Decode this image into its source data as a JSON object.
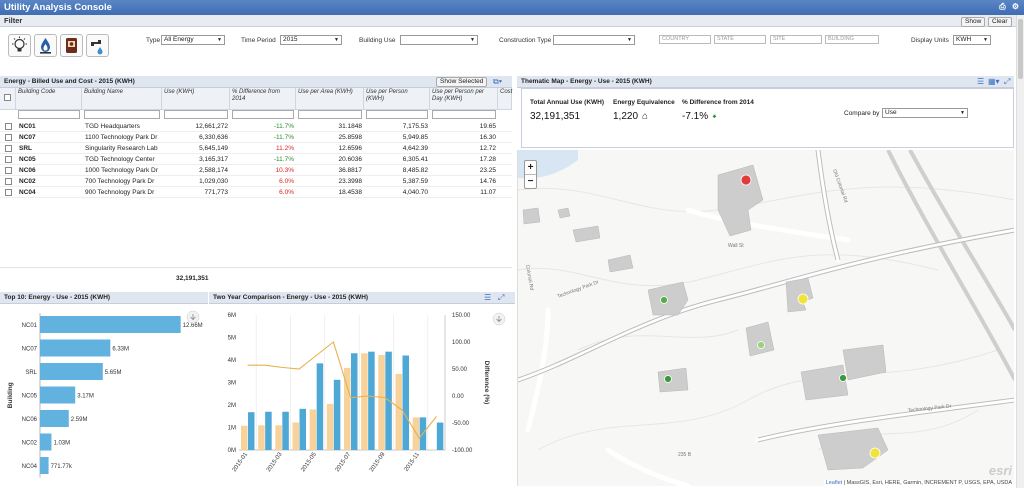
{
  "app": {
    "title": "Utility Analysis Console"
  },
  "filter": {
    "section_label": "Filter",
    "show_label": "Show",
    "clear_label": "Clear",
    "type_label": "Type",
    "type_value": "All Energy",
    "period_label": "Time Period",
    "period_value": "2015",
    "building_use_label": "Building Use",
    "building_use_value": "",
    "construction_label": "Construction Type",
    "construction_value": "",
    "country_ph": "COUNTRY",
    "state_ph": "STATE",
    "site_ph": "SITE",
    "building_ph": "BUILDING",
    "units_label": "Display Units",
    "units_value": "KWH",
    "icons": [
      "electricity-icon",
      "gas-icon",
      "fuel-oil-icon",
      "water-icon"
    ]
  },
  "grid": {
    "title": "Energy - Billed Use and Cost - 2015 (KWH)",
    "show_selected": "Show Selected",
    "columns": [
      "Building Code",
      "Building Name",
      "Use (KWH)",
      "% Difference from 2014",
      "Use per Area (KWH)",
      "Use per Person (KWH)",
      "Use per Person per Day (KWH)",
      "Cost"
    ],
    "rows": [
      {
        "code": "NC01",
        "name": "TGD Headquarters",
        "use": "12,661,272",
        "diff": "-11.7%",
        "area": "31.1848",
        "person": "7,175.53",
        "day": "19.65",
        "neg": false
      },
      {
        "code": "NC07",
        "name": "1100 Technology Park Dr",
        "use": "6,330,636",
        "diff": "-11.7%",
        "area": "25.8598",
        "person": "5,949.85",
        "day": "16.30",
        "neg": false
      },
      {
        "code": "SRL",
        "name": "Singularity Research Lab",
        "use": "5,645,149",
        "diff": "11.2%",
        "area": "12.6596",
        "person": "4,642.39",
        "day": "12.72",
        "neg": true
      },
      {
        "code": "NC05",
        "name": "TGD Technology Center",
        "use": "3,165,317",
        "diff": "-11.7%",
        "area": "20.6036",
        "person": "6,305.41",
        "day": "17.28",
        "neg": false
      },
      {
        "code": "NC06",
        "name": "1000 Technology Park Dr",
        "use": "2,588,174",
        "diff": "10.3%",
        "area": "36.8817",
        "person": "8,485.82",
        "day": "23.25",
        "neg": true
      },
      {
        "code": "NC02",
        "name": "700 Technology Park Dr",
        "use": "1,029,030",
        "diff": "6.0%",
        "area": "23.3998",
        "person": "5,387.59",
        "day": "14.76",
        "neg": true
      },
      {
        "code": "NC04",
        "name": "900 Technology Park Dr",
        "use": "771,773",
        "diff": "6.0%",
        "area": "18.4538",
        "person": "4,040.70",
        "day": "11.07",
        "neg": true
      }
    ],
    "total": "32,191,351"
  },
  "thematic": {
    "title": "Thematic Map - Energy - Use - 2015 (KWH)",
    "total_label": "Total Annual Use (KWH)",
    "total_value": "32,191,351",
    "equiv_label": "Energy Equivalence",
    "equiv_value": "1,220",
    "diff_label": "% Difference from 2014",
    "diff_value": "-7.1%",
    "compare_label": "Compare by",
    "compare_value": "Use"
  },
  "map": {
    "streets": [
      "Old Colonial Rd",
      "Wall St",
      "Technology Park Dr",
      "Technology Park Dr",
      "Colonial Rd",
      "235 B"
    ],
    "attribution_link": "Leaflet",
    "attribution": "| MassGIS, Esri, HERE, Garmin, INCREMENT P, USGS, EPA, USDA",
    "watermark": "esri",
    "markers": [
      {
        "name": "NC01",
        "color": "#e23b3b"
      },
      {
        "name": "NC07",
        "color": "#f2e33a"
      },
      {
        "name": "SRL",
        "color": "#52b04a"
      },
      {
        "name": "NC05",
        "color": "#9bd07a"
      },
      {
        "name": "NC06",
        "color": "#3a9a3a"
      },
      {
        "name": "NC02",
        "color": "#3a9a3a"
      },
      {
        "name": "NC04",
        "color": "#f2e33a"
      }
    ]
  },
  "chart_data": [
    {
      "type": "bar",
      "orientation": "horizontal",
      "title": "Top 10: Energy - Use - 2015 (KWH)",
      "ylabel": "Building",
      "categories": [
        "NC01",
        "NC07",
        "SRL",
        "NC05",
        "NC06",
        "NC02",
        "NC04"
      ],
      "values": [
        12.66,
        6.33,
        5.65,
        3.17,
        2.59,
        1.03,
        0.77173
      ],
      "labels": [
        "12.66M",
        "6.33M",
        "5.65M",
        "3.17M",
        "2.59M",
        "1.03M",
        "771.77k"
      ],
      "xlim": [
        0,
        13.5
      ],
      "color": "#62b2e0"
    },
    {
      "type": "bar",
      "title": "Two Year Comparison - Energy - Use - 2015 (KWH)",
      "ylabel_right": "Difference (%)",
      "x": [
        "2015-01",
        "2015-02",
        "2015-03",
        "2015-04",
        "2015-05",
        "2015-06",
        "2015-07",
        "2015-08",
        "2015-09",
        "2015-10",
        "2015-11",
        "2015-12"
      ],
      "x_ticks": [
        "2015-01",
        "2015-03",
        "2015-05",
        "2015-07",
        "2015-09",
        "2015-11"
      ],
      "y_ticks": [
        "0M",
        "1M",
        "2M",
        "3M",
        "4M",
        "5M",
        "6M"
      ],
      "y2_ticks": [
        "150.00",
        "100.00",
        "50.00",
        "0.00",
        "-50.00",
        "-100.00"
      ],
      "ylim": [
        0,
        6
      ],
      "y2lim": [
        -100,
        150
      ],
      "series": [
        {
          "values": [
            1.08,
            1.1,
            1.1,
            1.22,
            1.8,
            2.05,
            3.65,
            4.3,
            4.22,
            3.38,
            1.45,
            0.02
          ],
          "color": "#f7d29a"
        },
        {
          "values": [
            1.68,
            1.7,
            1.7,
            1.83,
            3.85,
            3.12,
            4.3,
            4.37,
            4.37,
            4.2,
            1.45,
            1.22
          ],
          "color": "#4da8d6"
        },
        {
          "kind": "line",
          "values": [
            57,
            57,
            53,
            50,
            75,
            100,
            -3,
            0,
            -3,
            -26,
            -78,
            -38
          ],
          "color": "#e8b04f"
        }
      ]
    }
  ]
}
